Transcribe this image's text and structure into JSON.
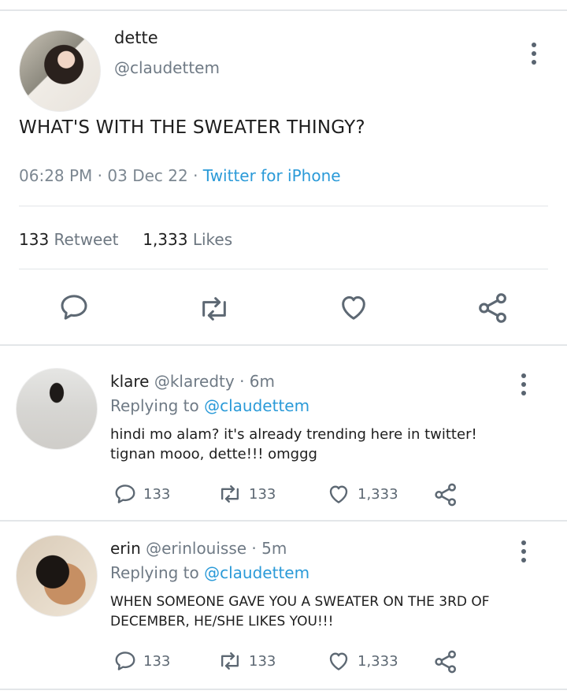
{
  "main": {
    "name": "dette",
    "handle": "@claudettem",
    "text": "WHAT'S WITH THE SWEATER THINGY?",
    "time": "06:28 PM",
    "date": "03 Dec 22",
    "source": "Twitter for iPhone",
    "retweets": "133",
    "retweets_label": "Retweet",
    "likes": "1,333",
    "likes_label": "Likes"
  },
  "replies": [
    {
      "name": "klare",
      "handle": "@klaredty",
      "time": "6m",
      "replying_label": "Replying to",
      "replying_to": "@claudettem",
      "text": "hindi mo alam? it's already trending here in twitter! tignan mooo, dette!!! omggg",
      "comments": "133",
      "retweets": "133",
      "likes": "1,333"
    },
    {
      "name": "erin",
      "handle": "@erinlouisse",
      "time": "5m",
      "replying_label": "Replying to",
      "replying_to": "@claudettem",
      "text": "WHEN SOMEONE GAVE YOU A SWEATER ON THE 3RD OF DECEMBER, HE/SHE LIKES YOU!!!",
      "comments": "133",
      "retweets": "133",
      "likes": "1,333"
    }
  ],
  "colors": {
    "link": "#2a9ad8",
    "icon": "#5d6873",
    "muted": "#6f7a85"
  },
  "icons": [
    "comment-icon",
    "retweet-icon",
    "heart-icon",
    "share-icon",
    "more-options-icon"
  ]
}
